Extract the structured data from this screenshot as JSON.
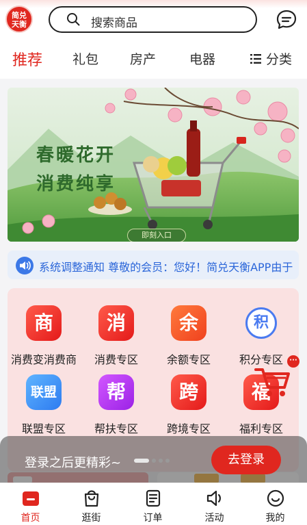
{
  "header": {
    "logo_text": "简兑天衡",
    "search_placeholder": "搜索商品",
    "icons": {
      "search": "search-icon",
      "message": "message-icon"
    }
  },
  "tabs": [
    {
      "label": "推荐",
      "active": true
    },
    {
      "label": "礼包",
      "active": false
    },
    {
      "label": "房产",
      "active": false
    },
    {
      "label": "电器",
      "active": false
    }
  ],
  "category_label": "分类",
  "banner": {
    "title_line1": "春暖花开",
    "title_line2": "消费纯享",
    "button_text": "即刻入口"
  },
  "notice": {
    "text": "系统调整通知 尊敬的会员：您好！简兑天衡APP由于"
  },
  "grid": {
    "row1": [
      {
        "icon_text": "商",
        "label": "消费变消费商"
      },
      {
        "icon_text": "消",
        "label": "消费专区"
      },
      {
        "icon_text": "余",
        "label": "余额专区"
      },
      {
        "icon_text": "积",
        "label": "积分专区"
      }
    ],
    "row2": [
      {
        "icon_text": "联盟",
        "label": "联盟专区"
      },
      {
        "icon_text": "帮",
        "label": "帮扶专区"
      },
      {
        "icon_text": "跨",
        "label": "跨境专区"
      },
      {
        "icon_text": "福",
        "label": "福利专区"
      }
    ]
  },
  "more_dot": "···",
  "login_prompt": {
    "text": "登录之后更精彩~",
    "button": "去登录"
  },
  "bottom_nav": [
    {
      "label": "首页",
      "icon": "home-icon",
      "active": true
    },
    {
      "label": "逛街",
      "icon": "shopping-bag-icon",
      "active": false
    },
    {
      "label": "订单",
      "icon": "order-list-icon",
      "active": false
    },
    {
      "label": "活动",
      "icon": "speaker-icon",
      "active": false
    },
    {
      "label": "我的",
      "icon": "profile-icon",
      "active": false
    }
  ],
  "colors": {
    "brand": "#e0271f",
    "notice_blue": "#2b66d9",
    "grid_bg": "#fae1e1"
  }
}
